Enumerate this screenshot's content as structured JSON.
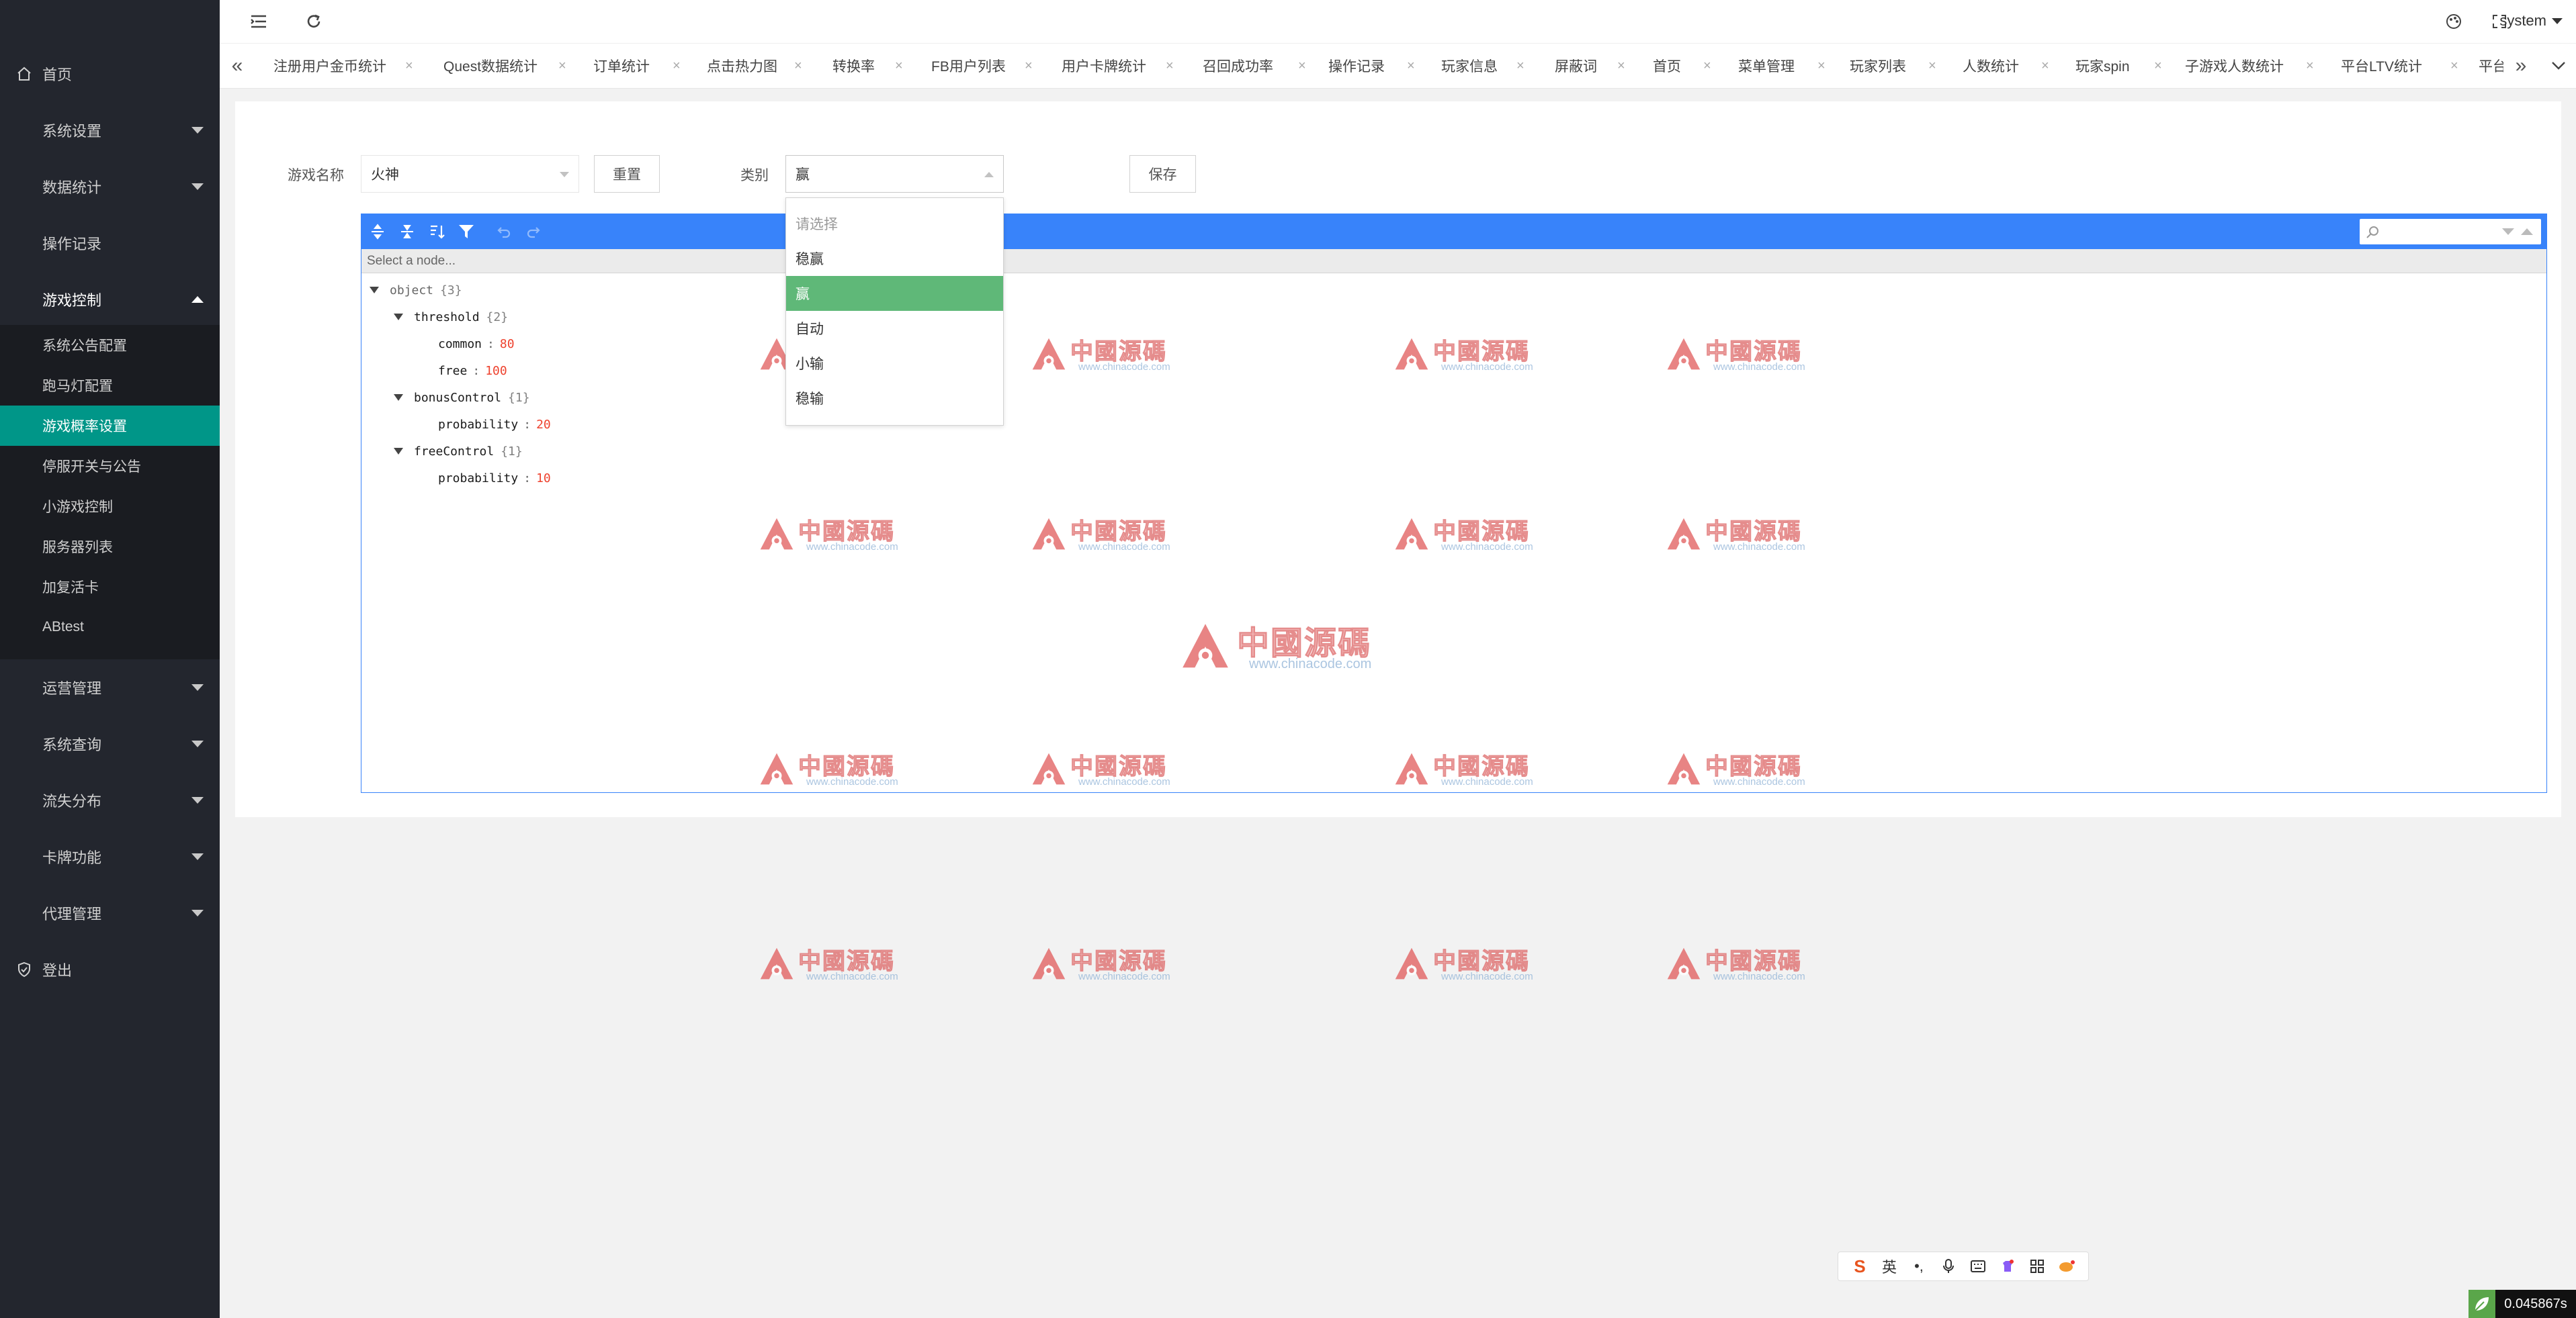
{
  "sidebar": {
    "home": "首页",
    "items": [
      {
        "label": "系统设置"
      },
      {
        "label": "数据统计"
      },
      {
        "label": "操作记录"
      },
      {
        "label": "游戏控制"
      },
      {
        "label": "运营管理"
      },
      {
        "label": "系统查询"
      },
      {
        "label": "流失分布"
      },
      {
        "label": "卡牌功能"
      },
      {
        "label": "代理管理"
      }
    ],
    "sub_items": [
      {
        "label": "系统公告配置"
      },
      {
        "label": "跑马灯配置"
      },
      {
        "label": "游戏概率设置"
      },
      {
        "label": "停服开关与公告"
      },
      {
        "label": "小游戏控制"
      },
      {
        "label": "服务器列表"
      },
      {
        "label": "加复活卡"
      },
      {
        "label": "ABtest"
      }
    ],
    "logout": "登出"
  },
  "header": {
    "user": "system"
  },
  "tabs": [
    {
      "label": "注册用户金币统计"
    },
    {
      "label": "Quest数据统计"
    },
    {
      "label": "订单统计"
    },
    {
      "label": "点击热力图"
    },
    {
      "label": "转换率"
    },
    {
      "label": "FB用户列表"
    },
    {
      "label": "用户卡牌统计"
    },
    {
      "label": "召回成功率"
    },
    {
      "label": "操作记录"
    },
    {
      "label": "玩家信息"
    },
    {
      "label": "屏蔽词"
    },
    {
      "label": "首页"
    },
    {
      "label": "菜单管理"
    },
    {
      "label": "玩家列表"
    },
    {
      "label": "人数统计"
    },
    {
      "label": "玩家spin"
    },
    {
      "label": "子游戏人数统计"
    },
    {
      "label": "平台LTV统计"
    },
    {
      "label": "平台"
    }
  ],
  "tab_close_glyph": "×",
  "form": {
    "game_name_label": "游戏名称",
    "game_name_value": "火神",
    "reset_button": "重置",
    "category_label": "类别",
    "category_value": "赢",
    "save_button": "保存"
  },
  "dropdown": {
    "options": [
      {
        "label": "请选择"
      },
      {
        "label": "稳赢"
      },
      {
        "label": "赢"
      },
      {
        "label": "自动"
      },
      {
        "label": "小输"
      },
      {
        "label": "稳输"
      }
    ],
    "selected_index": 2
  },
  "editor": {
    "nav_text": "Select a node...",
    "tree": {
      "root": {
        "key": "object",
        "count": "{3}"
      },
      "threshold": {
        "key": "threshold",
        "count": "{2}"
      },
      "common": {
        "key": "common",
        "value": "80"
      },
      "free": {
        "key": "free",
        "value": "100"
      },
      "bonusControl": {
        "key": "bonusControl",
        "count": "{1}"
      },
      "bonus_probability": {
        "key": "probability",
        "value": "20"
      },
      "freeControl": {
        "key": "freeControl",
        "count": "{1}"
      },
      "free_probability": {
        "key": "probability",
        "value": "10"
      },
      "separator": ":"
    }
  },
  "watermark": {
    "title": "中國源碼",
    "url": "www.chinacode.com"
  },
  "ime": {
    "lang": "英"
  },
  "timer": "0.045867s",
  "colors": {
    "sidebar_bg": "#23262e",
    "sidebar_active": "#009688",
    "editor_blue": "#3883fa",
    "dropdown_selected": "#5fb878",
    "json_number": "#ee422e"
  }
}
